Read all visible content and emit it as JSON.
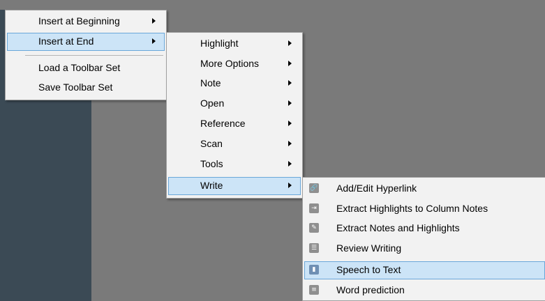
{
  "menu1": {
    "items": [
      {
        "label": "Insert at Beginning",
        "has_submenu": true,
        "selected": false
      },
      {
        "label": "Insert at End",
        "has_submenu": true,
        "selected": true
      },
      {
        "label": "Load a Toolbar Set",
        "has_submenu": false,
        "selected": false
      },
      {
        "label": "Save Toolbar Set",
        "has_submenu": false,
        "selected": false
      }
    ]
  },
  "menu2": {
    "items": [
      {
        "label": "Highlight",
        "has_submenu": true
      },
      {
        "label": "More Options",
        "has_submenu": true
      },
      {
        "label": "Note",
        "has_submenu": true
      },
      {
        "label": "Open",
        "has_submenu": true
      },
      {
        "label": "Reference",
        "has_submenu": true
      },
      {
        "label": "Scan",
        "has_submenu": true
      },
      {
        "label": "Tools",
        "has_submenu": true
      },
      {
        "label": "Write",
        "has_submenu": true,
        "selected": true
      }
    ]
  },
  "menu3": {
    "items": [
      {
        "label": "Add/Edit Hyperlink",
        "icon": "hyperlink-icon"
      },
      {
        "label": "Extract Highlights to Column Notes",
        "icon": "extract-highlights-icon"
      },
      {
        "label": "Extract Notes and Highlights",
        "icon": "extract-notes-icon"
      },
      {
        "label": "Review Writing",
        "icon": "review-writing-icon"
      },
      {
        "label": "Speech to Text",
        "icon": "microphone-icon",
        "selected": true
      },
      {
        "label": "Word prediction",
        "icon": "word-prediction-icon"
      }
    ]
  },
  "colors": {
    "menu_bg": "#f2f2f2",
    "selection_bg": "#cce4f7",
    "selection_border": "#6aa7d9",
    "desktop_bg": "#7a7a7a"
  }
}
